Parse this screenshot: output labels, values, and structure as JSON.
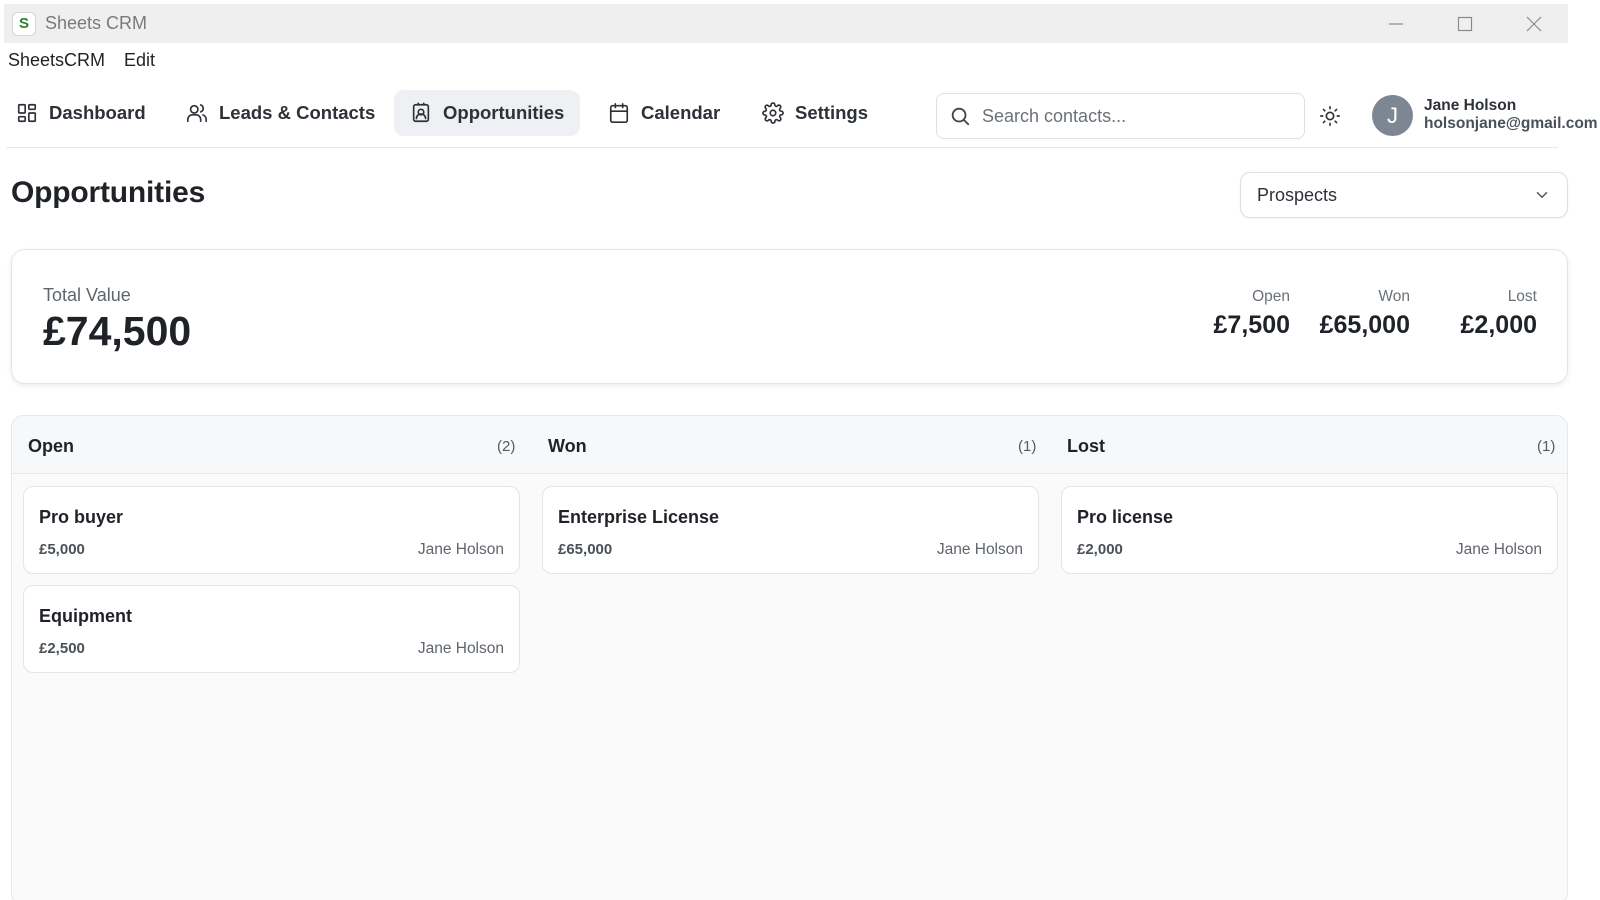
{
  "window": {
    "title": "Sheets CRM",
    "logo_letter": "S"
  },
  "menu": [
    "SheetsCRM",
    "Edit"
  ],
  "nav": {
    "items": [
      {
        "label": "Dashboard",
        "icon": "dashboard-icon"
      },
      {
        "label": "Leads & Contacts",
        "icon": "users-icon"
      },
      {
        "label": "Opportunities",
        "icon": "contact-card-icon",
        "active": true
      },
      {
        "label": "Calendar",
        "icon": "calendar-icon"
      },
      {
        "label": "Settings",
        "icon": "gear-icon"
      }
    ],
    "search_placeholder": "Search contacts...",
    "theme_icon": "sun-icon"
  },
  "user": {
    "initial": "J",
    "name": "Jane Holson",
    "email": "holsonjane@gmail.com"
  },
  "page": {
    "title": "Opportunities",
    "pipeline_select": "Prospects"
  },
  "summary": {
    "total_label": "Total Value",
    "total_value": "£74,500",
    "stats": [
      {
        "label": "Open",
        "value": "£7,500"
      },
      {
        "label": "Won",
        "value": "£65,000"
      },
      {
        "label": "Lost",
        "value": "£2,000"
      }
    ]
  },
  "board": {
    "columns": [
      {
        "title": "Open",
        "count": "(2)",
        "cards": [
          {
            "title": "Pro buyer",
            "value": "£5,000",
            "owner": "Jane Holson"
          },
          {
            "title": "Equipment",
            "value": "£2,500",
            "owner": "Jane Holson"
          }
        ]
      },
      {
        "title": "Won",
        "count": "(1)",
        "cards": [
          {
            "title": "Enterprise License",
            "value": "£65,000",
            "owner": "Jane Holson"
          }
        ]
      },
      {
        "title": "Lost",
        "count": "(1)",
        "cards": [
          {
            "title": "Pro license",
            "value": "£2,000",
            "owner": "Jane Holson"
          }
        ]
      }
    ]
  }
}
